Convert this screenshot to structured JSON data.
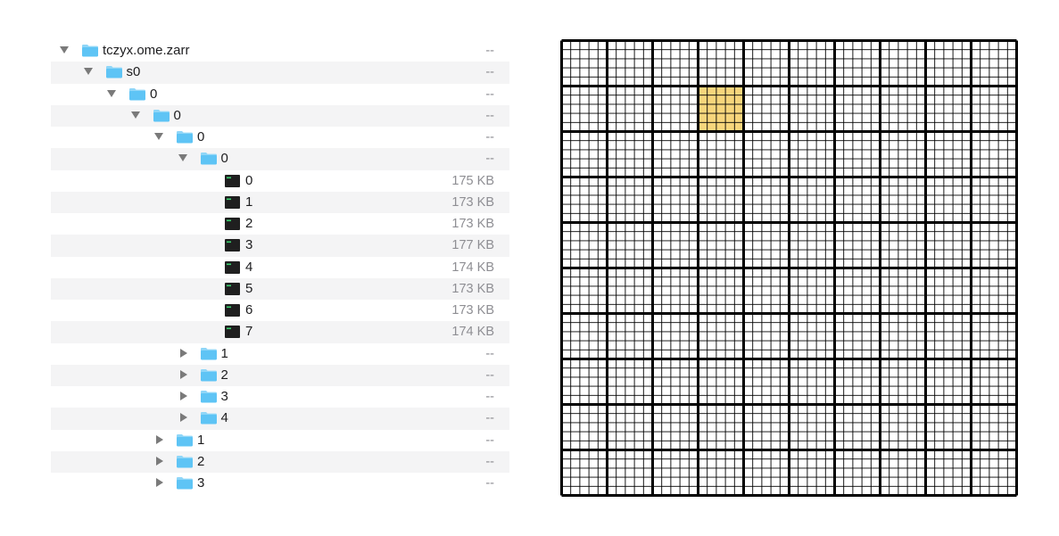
{
  "file_tree": {
    "rows": [
      {
        "name": "tczyx.ome.zarr",
        "size": "--",
        "depth": 0,
        "kind": "folder",
        "expanded": true
      },
      {
        "name": "s0",
        "size": "--",
        "depth": 1,
        "kind": "folder",
        "expanded": true
      },
      {
        "name": "0",
        "size": "--",
        "depth": 2,
        "kind": "folder",
        "expanded": true
      },
      {
        "name": "0",
        "size": "--",
        "depth": 3,
        "kind": "folder",
        "expanded": true
      },
      {
        "name": "0",
        "size": "--",
        "depth": 4,
        "kind": "folder",
        "expanded": true
      },
      {
        "name": "0",
        "size": "--",
        "depth": 5,
        "kind": "folder",
        "expanded": true
      },
      {
        "name": "0",
        "size": "175 KB",
        "depth": 6,
        "kind": "file"
      },
      {
        "name": "1",
        "size": "173 KB",
        "depth": 6,
        "kind": "file"
      },
      {
        "name": "2",
        "size": "173 KB",
        "depth": 6,
        "kind": "file"
      },
      {
        "name": "3",
        "size": "177 KB",
        "depth": 6,
        "kind": "file"
      },
      {
        "name": "4",
        "size": "174 KB",
        "depth": 6,
        "kind": "file"
      },
      {
        "name": "5",
        "size": "173 KB",
        "depth": 6,
        "kind": "file"
      },
      {
        "name": "6",
        "size": "173 KB",
        "depth": 6,
        "kind": "file"
      },
      {
        "name": "7",
        "size": "174 KB",
        "depth": 6,
        "kind": "file"
      },
      {
        "name": "1",
        "size": "--",
        "depth": 5,
        "kind": "folder",
        "expanded": false
      },
      {
        "name": "2",
        "size": "--",
        "depth": 5,
        "kind": "folder",
        "expanded": false
      },
      {
        "name": "3",
        "size": "--",
        "depth": 5,
        "kind": "folder",
        "expanded": false
      },
      {
        "name": "4",
        "size": "--",
        "depth": 5,
        "kind": "folder",
        "expanded": false
      },
      {
        "name": "1",
        "size": "--",
        "depth": 4,
        "kind": "folder",
        "expanded": false
      },
      {
        "name": "2",
        "size": "--",
        "depth": 4,
        "kind": "folder",
        "expanded": false
      },
      {
        "name": "3",
        "size": "--",
        "depth": 4,
        "kind": "folder",
        "expanded": false
      }
    ]
  },
  "chunk_grid": {
    "chunks_per_side": 10,
    "cells_per_chunk": 5,
    "highlighted_chunk": {
      "row": 1,
      "col": 3
    },
    "highlight_color": "#f7d67c",
    "line_color": "#000000"
  },
  "colors": {
    "folder": "#5ec4f5",
    "folder_tab": "#8fd6f8",
    "chunk_file": "#1f1f1f",
    "chunk_file_accent": "#3bd16f",
    "size_text": "#8e8e93",
    "alt_row": "#f4f4f5"
  }
}
